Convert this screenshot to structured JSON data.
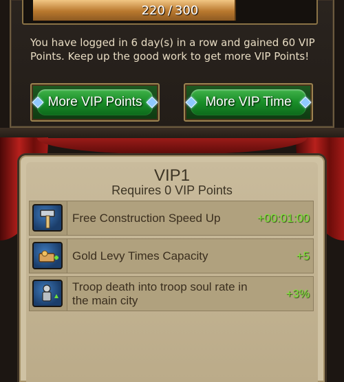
{
  "progress": {
    "current": "220",
    "separator": "/",
    "max": "300",
    "fraction": 0.733
  },
  "login_message": "You have logged in 6 day(s) in a row and gained 60 VIP Points.  Keep up the good work to get more VIP Points!",
  "buttons": {
    "more_vip_points": "More VIP Points",
    "more_vip_time": "More VIP Time"
  },
  "vip": {
    "level": "VIP1",
    "requirement": "Requires 0 VIP Points"
  },
  "perks": [
    {
      "icon": "hammer-icon",
      "name": "Free Construction Speed Up",
      "value": "+00:01:00"
    },
    {
      "icon": "gold-levy-icon",
      "name": "Gold Levy Times Capacity",
      "value": "+5"
    },
    {
      "icon": "troop-soul-icon",
      "name": "Troop death into troop soul rate in the main city",
      "value": "+3%"
    }
  ],
  "colors": {
    "accent_green": "#7fe23a",
    "button_green": "#198e28",
    "progress_fill": "#b9782e",
    "curtain_red": "#b7201c"
  }
}
